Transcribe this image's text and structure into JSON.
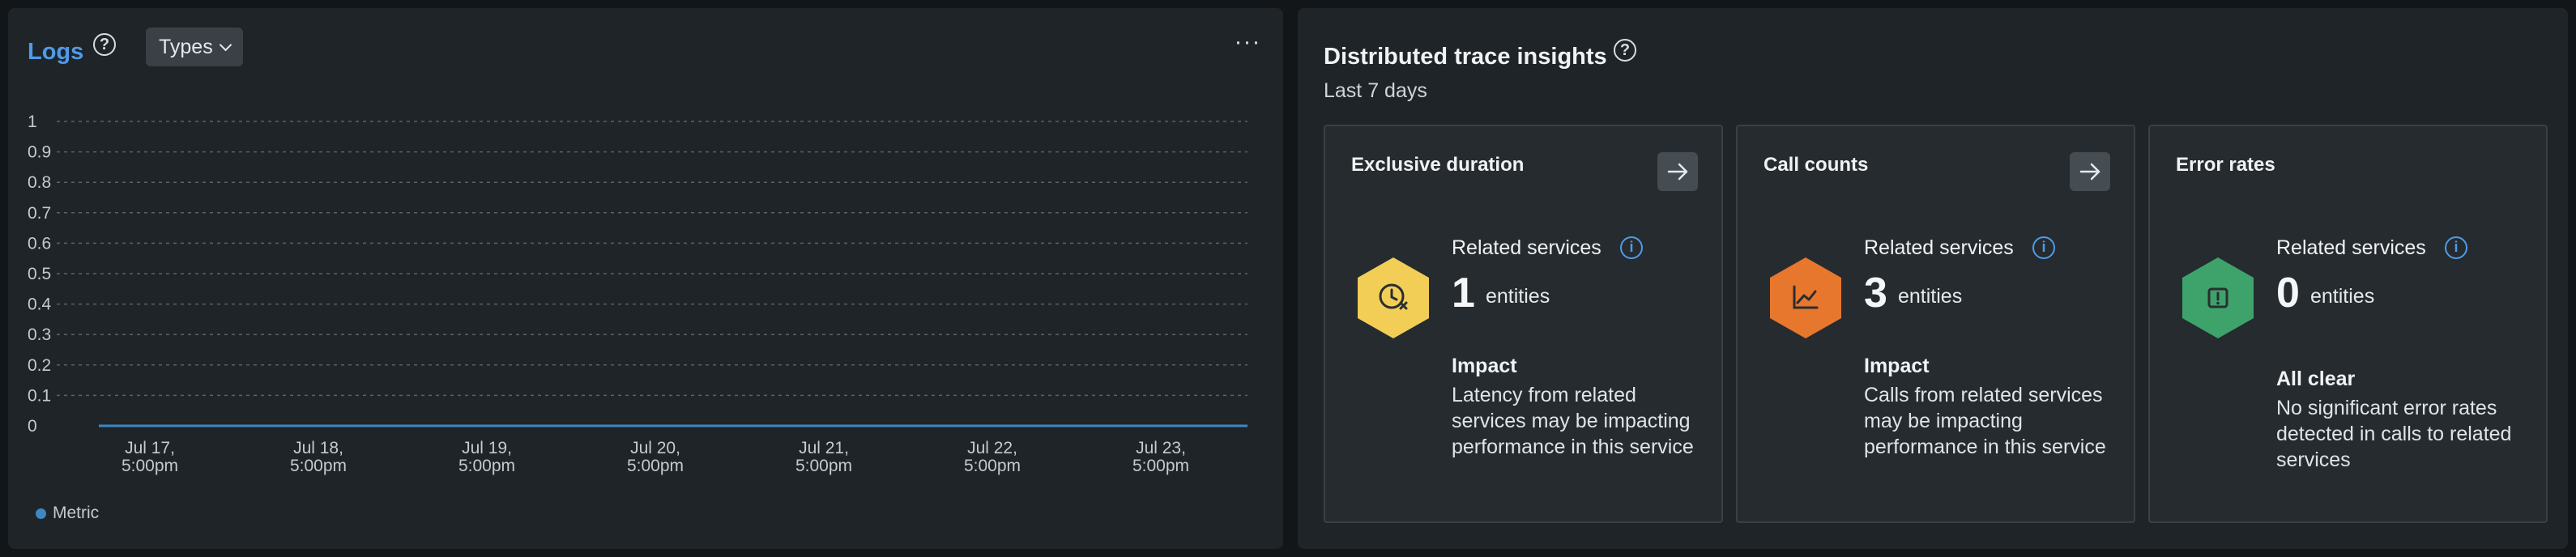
{
  "logs": {
    "title": "Logs",
    "types_label": "Types",
    "more_label": "···",
    "legend_label": "Metric"
  },
  "chart_data": {
    "type": "line",
    "title": "",
    "xlabel": "",
    "ylabel": "",
    "ylim": [
      0,
      1
    ],
    "yticks": [
      "1",
      "0.9",
      "0.8",
      "0.7",
      "0.6",
      "0.5",
      "0.4",
      "0.3",
      "0.2",
      "0.1",
      "0"
    ],
    "xticks": [
      [
        "Jul 17,",
        "5:00pm"
      ],
      [
        "Jul 18,",
        "5:00pm"
      ],
      [
        "Jul 19,",
        "5:00pm"
      ],
      [
        "Jul 20,",
        "5:00pm"
      ],
      [
        "Jul 21,",
        "5:00pm"
      ],
      [
        "Jul 22,",
        "5:00pm"
      ],
      [
        "Jul 23,",
        "5:00pm"
      ]
    ],
    "grid": true,
    "legend_position": "bottom-left",
    "series": [
      {
        "name": "Metric",
        "color": "#3d88c4",
        "values": [
          0,
          0,
          0,
          0,
          0,
          0,
          0
        ]
      }
    ]
  },
  "trace": {
    "title": "Distributed trace insights",
    "subtitle": "Last 7 days",
    "cards": [
      {
        "title": "Exclusive duration",
        "related_label": "Related services",
        "count": "1",
        "count_unit": "entities",
        "impact_title": "Impact",
        "impact_text": "Latency from related services may be impacting performance in this service",
        "icon": "clock-icon",
        "hex_color": "#f3ce56",
        "has_arrow": true
      },
      {
        "title": "Call counts",
        "related_label": "Related services",
        "count": "3",
        "count_unit": "entities",
        "impact_title": "Impact",
        "impact_text": "Calls from related services may be impacting performance in this service",
        "icon": "chart-icon",
        "hex_color": "#e8772e",
        "has_arrow": true
      },
      {
        "title": "Error rates",
        "related_label": "Related services",
        "count": "0",
        "count_unit": "entities",
        "impact_title": "All clear",
        "impact_text": "No significant error rates detected in calls to related services",
        "icon": "alert-icon",
        "hex_color": "#3da36b",
        "has_arrow": false
      }
    ]
  }
}
